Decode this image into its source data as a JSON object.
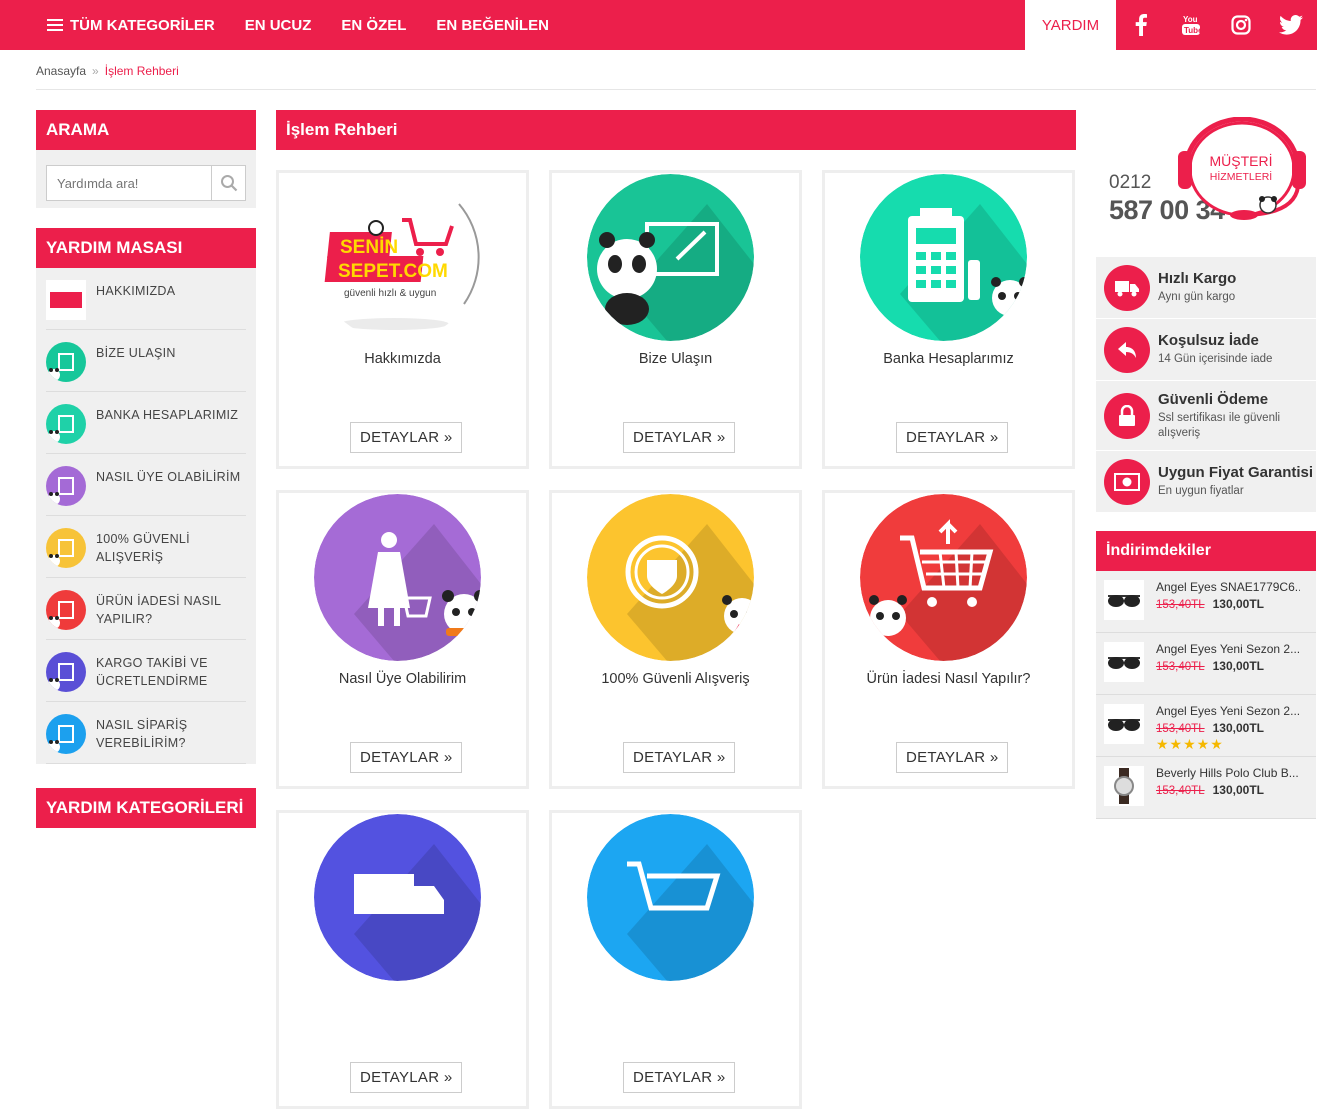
{
  "nav": {
    "items": [
      "TÜM KATEGORİLER",
      "EN UCUZ",
      "EN ÖZEL",
      "EN BEĞENİLEN"
    ],
    "help": "YARDIM",
    "social": [
      "facebook-icon",
      "youtube-icon",
      "instagram-icon",
      "twitter-icon"
    ]
  },
  "breadcrumb": {
    "home": "Anasayfa",
    "sep": "»",
    "current": "İşlem Rehberi"
  },
  "search": {
    "title": "ARAMA",
    "placeholder": "Yardımda ara!"
  },
  "help_desk": {
    "title": "YARDIM MASASI",
    "items": [
      {
        "label": "HAKKIMIZDA",
        "color": "#ffffff"
      },
      {
        "label": "BİZE ULAŞIN",
        "color": "#16c79a"
      },
      {
        "label": "BANKA HESAPLARIMIZ",
        "color": "#1fd1a8"
      },
      {
        "label": "NASIL ÜYE OLABİLİRİM",
        "color": "#a46ad6"
      },
      {
        "label": "100% GÜVENLİ ALIŞVERİŞ",
        "color": "#f7c338"
      },
      {
        "label": "ÜRÜN İADESİ NASIL YAPILIR?",
        "color": "#ef3b3b"
      },
      {
        "label": "KARGO TAKİBİ VE ÜCRETLENDİRME",
        "color": "#5a4fd6"
      },
      {
        "label": "NASIL SİPARİŞ VEREBİLİRİM?",
        "color": "#1ca0ee"
      }
    ]
  },
  "help_categories": {
    "title": "YARDIM KATEGORİLERİ"
  },
  "main": {
    "title": "İşlem Rehberi",
    "cards": [
      {
        "title": "Hakkımızda",
        "color": "#ffffff",
        "icon": "logo"
      },
      {
        "title": "Bize Ulaşın",
        "color": "#19c496",
        "icon": "panda-envelope-icon"
      },
      {
        "title": "Banka Hesaplarımız",
        "color": "#16dcae",
        "icon": "pos-terminal-icon"
      },
      {
        "title": "Nasıl Üye Olabilirim",
        "color": "#a56bd6",
        "icon": "woman-cart-icon"
      },
      {
        "title": "100% Güvenli Alışveriş",
        "color": "#fcc42e",
        "icon": "shield-icon"
      },
      {
        "title": "Ürün İadesi Nasıl Yapılır?",
        "color": "#f03c3c",
        "icon": "cart-return-icon"
      },
      {
        "title": "",
        "color": "#5352e0",
        "icon": "truck-icon"
      },
      {
        "title": "",
        "color": "#1ca6f2",
        "icon": "cart-order-icon"
      }
    ],
    "button": "DETAYLAR »"
  },
  "logo": {
    "line1": "SENİN",
    "line2": "SEPET.COM",
    "tagline": "güvenli hızlı & uygun"
  },
  "support": {
    "prefix": "0212",
    "number": "587 00 34",
    "label1": "MÜŞTERİ",
    "label2": "HİZMETLERİ"
  },
  "features": [
    {
      "title": "Hızlı Kargo",
      "sub": "Aynı gün kargo",
      "icon": "truck-icon"
    },
    {
      "title": "Koşulsuz İade",
      "sub": "14 Gün içerisinde iade",
      "icon": "return-arrow-icon"
    },
    {
      "title": "Güvenli Ödeme",
      "sub": "Ssl sertifikası ile güvenli alışveriş",
      "icon": "lock-icon"
    },
    {
      "title": "Uygun Fiyat Garantisi",
      "sub": "En uygun fiyatlar",
      "icon": "money-icon"
    }
  ],
  "discounts": {
    "title": "İndirimdekiler",
    "items": [
      {
        "name": "Angel Eyes SNAE1779C6...",
        "old": "153,40TL",
        "new": "130,00TL",
        "rating": 0,
        "icon": "sunglasses-icon"
      },
      {
        "name": "Angel Eyes Yeni Sezon 2...",
        "old": "153,40TL",
        "new": "130,00TL",
        "rating": 0,
        "icon": "sunglasses-icon"
      },
      {
        "name": "Angel Eyes Yeni Sezon 2...",
        "old": "153,40TL",
        "new": "130,00TL",
        "rating": 5,
        "icon": "sunglasses-icon"
      },
      {
        "name": "Beverly Hills Polo Club B...",
        "old": "153,40TL",
        "new": "130,00TL",
        "rating": 0,
        "icon": "watch-icon"
      }
    ]
  },
  "stars_text": "★★★★★"
}
